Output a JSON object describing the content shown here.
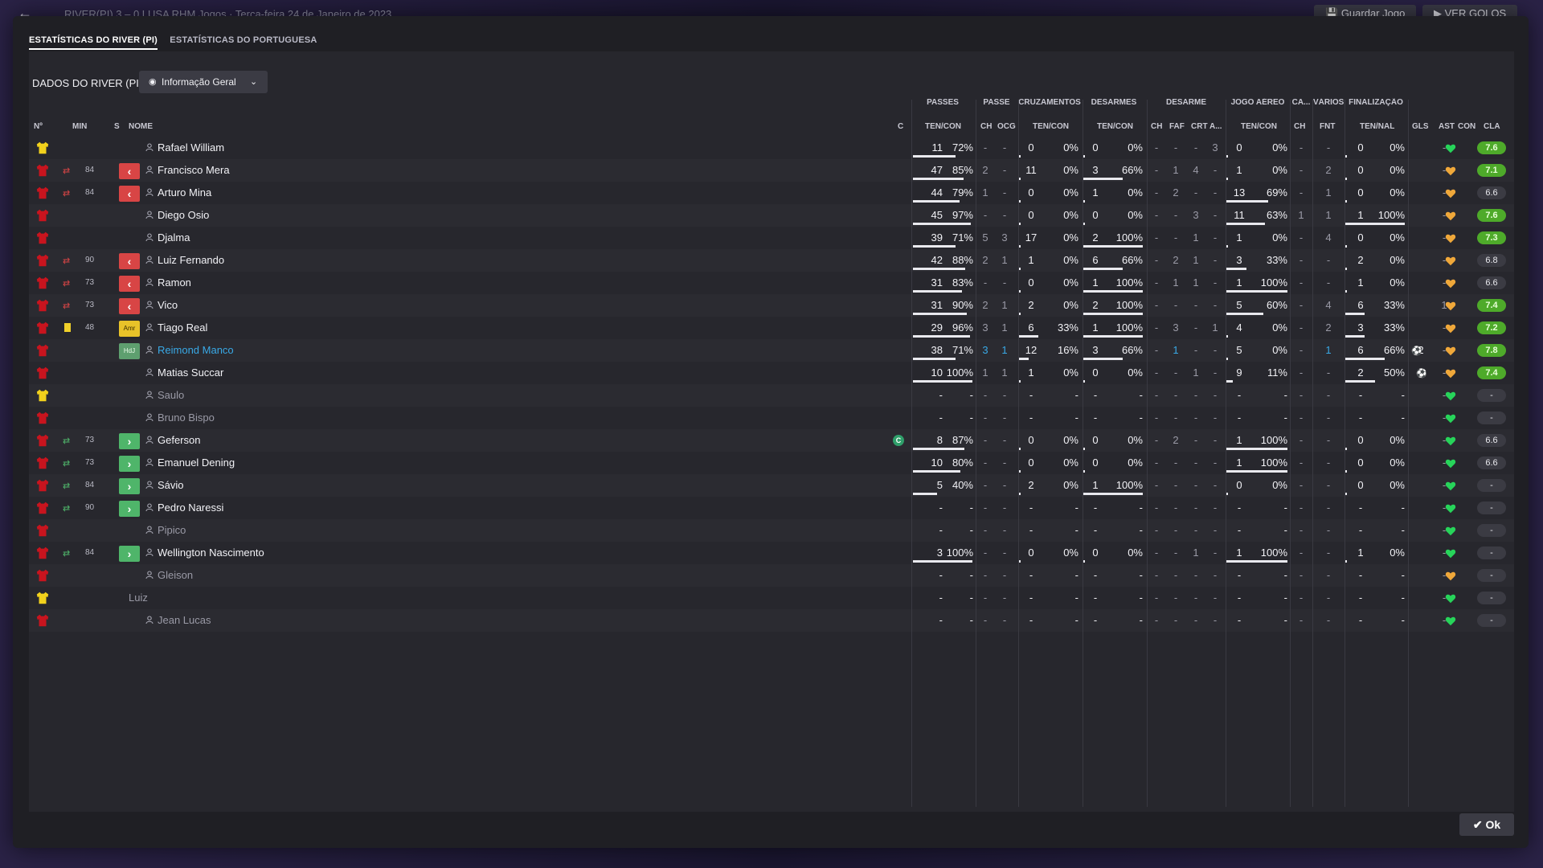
{
  "topbar": {
    "score": "RIVER(PI)  3 – 0  LUSA    RHM Jogos  ·  Terça-feira 24 de Janeiro de 2023",
    "save_label": "Guardar Jogo",
    "goals_label": "VER GOLOS"
  },
  "tabs": [
    "ESTATÍSTICAS DO RIVER (PI)",
    "ESTATÍSTICAS DO PORTUGUESA"
  ],
  "panel_title": "DADOS DO RIVER (PI)",
  "view_dropdown": "Informação Geral",
  "group_headers": {
    "passes": "PASSES",
    "passe": "PASSE",
    "cruzamentos": "CRUZAMENTOS",
    "desarmes": "DESARMES",
    "desarme": "DESARME",
    "jogo_aereo": "JOGO AÉREO",
    "ca": "CA...",
    "varios": "VÁRIOS",
    "finalizacao": "FINALIZAÇÃO"
  },
  "columns": {
    "no": "Nº",
    "min": "MIN",
    "s": "S",
    "nome": "NOME",
    "c": "C",
    "passes_tc": "TEN/CON",
    "ch1": "CH",
    "ocg": "OCG",
    "cruz_tc": "TEN/CON",
    "des_tc": "TEN/CON",
    "ch2": "CH",
    "faf": "FAF",
    "crt": "CRT",
    "a": "A...",
    "aer_tc": "TEN/CON",
    "ch3": "CH",
    "fnt": "FNT",
    "fin_tn": "TEN/NAL",
    "gls": "GLS",
    "ast": "AST",
    "con": "CON",
    "cla": "CLA"
  },
  "players": [
    {
      "kit": "gk",
      "min": "",
      "sub": "",
      "pos": "",
      "name": "Rafael William",
      "card": false,
      "c": "",
      "p": [
        "11",
        "72%"
      ],
      "ch1": "-",
      "ocg": "-",
      "cr": [
        "0",
        "0%"
      ],
      "de": [
        "0",
        "0%"
      ],
      "ch2": "-",
      "faf": "-",
      "crt": "-",
      "a": "3",
      "ae": [
        "0",
        "0%"
      ],
      "ch3": "-",
      "fnt": "-",
      "fi": [
        "0",
        "0%"
      ],
      "gls": "",
      "ast": "-",
      "con": "green",
      "cla": "7.6",
      "good": true,
      "pf": 0.72,
      "cf": 0,
      "df": 0,
      "af": 0,
      "ff": 0
    },
    {
      "kit": "o",
      "min": "84",
      "sub": "out",
      "pos": "",
      "name": "Francisco Mera",
      "card": false,
      "c": "",
      "p": [
        "47",
        "85%"
      ],
      "ch1": "2",
      "ocg": "-",
      "cr": [
        "11",
        "0%"
      ],
      "de": [
        "3",
        "66%"
      ],
      "ch2": "-",
      "faf": "1",
      "crt": "4",
      "a": "-",
      "ae": [
        "1",
        "0%"
      ],
      "ch3": "-",
      "fnt": "2",
      "fi": [
        "0",
        "0%"
      ],
      "gls": "",
      "ast": "-",
      "con": "orange",
      "cla": "7.1",
      "good": true,
      "pf": 0.85,
      "cf": 0,
      "df": 0.66,
      "af": 0,
      "ff": 0
    },
    {
      "kit": "o",
      "min": "84",
      "sub": "out",
      "pos": "",
      "name": "Arturo Mina",
      "card": false,
      "c": "",
      "p": [
        "44",
        "79%"
      ],
      "ch1": "1",
      "ocg": "-",
      "cr": [
        "0",
        "0%"
      ],
      "de": [
        "1",
        "0%"
      ],
      "ch2": "-",
      "faf": "2",
      "crt": "-",
      "a": "-",
      "ae": [
        "13",
        "69%"
      ],
      "ch3": "-",
      "fnt": "1",
      "fi": [
        "0",
        "0%"
      ],
      "gls": "",
      "ast": "-",
      "con": "orange",
      "cla": "6.6",
      "good": false,
      "pf": 0.79,
      "cf": 0,
      "df": 0,
      "af": 0.69,
      "ff": 0
    },
    {
      "kit": "o",
      "min": "",
      "sub": "",
      "pos": "",
      "name": "Diego Osio",
      "card": false,
      "c": "",
      "p": [
        "45",
        "97%"
      ],
      "ch1": "-",
      "ocg": "-",
      "cr": [
        "0",
        "0%"
      ],
      "de": [
        "0",
        "0%"
      ],
      "ch2": "-",
      "faf": "-",
      "crt": "3",
      "a": "-",
      "ae": [
        "11",
        "63%"
      ],
      "ch3": "1",
      "fnt": "1",
      "fi": [
        "1",
        "100%"
      ],
      "gls": "",
      "ast": "-",
      "con": "orange",
      "cla": "7.6",
      "good": true,
      "pf": 0.97,
      "cf": 0,
      "df": 0,
      "af": 0.63,
      "ff": 1
    },
    {
      "kit": "o",
      "min": "",
      "sub": "",
      "pos": "",
      "name": "Djalma",
      "card": false,
      "c": "",
      "p": [
        "39",
        "71%"
      ],
      "ch1": "5",
      "ocg": "3",
      "cr": [
        "17",
        "0%"
      ],
      "de": [
        "2",
        "100%"
      ],
      "ch2": "-",
      "faf": "-",
      "crt": "1",
      "a": "-",
      "ae": [
        "1",
        "0%"
      ],
      "ch3": "-",
      "fnt": "4",
      "fi": [
        "0",
        "0%"
      ],
      "gls": "",
      "ast": "-",
      "con": "orange",
      "cla": "7.3",
      "good": true,
      "pf": 0.71,
      "cf": 0,
      "df": 1,
      "af": 0,
      "ff": 0
    },
    {
      "kit": "o",
      "min": "90",
      "sub": "out",
      "pos": "",
      "name": "Luiz Fernando",
      "card": false,
      "c": "",
      "p": [
        "42",
        "88%"
      ],
      "ch1": "2",
      "ocg": "1",
      "cr": [
        "1",
        "0%"
      ],
      "de": [
        "6",
        "66%"
      ],
      "ch2": "-",
      "faf": "2",
      "crt": "1",
      "a": "-",
      "ae": [
        "3",
        "33%"
      ],
      "ch3": "-",
      "fnt": "-",
      "fi": [
        "2",
        "0%"
      ],
      "gls": "",
      "ast": "-",
      "con": "orange",
      "cla": "6.8",
      "good": false,
      "pf": 0.88,
      "cf": 0,
      "df": 0.66,
      "af": 0.33,
      "ff": 0
    },
    {
      "kit": "o",
      "min": "73",
      "sub": "out",
      "pos": "",
      "name": "Ramon",
      "card": false,
      "c": "",
      "p": [
        "31",
        "83%"
      ],
      "ch1": "-",
      "ocg": "-",
      "cr": [
        "0",
        "0%"
      ],
      "de": [
        "1",
        "100%"
      ],
      "ch2": "-",
      "faf": "1",
      "crt": "1",
      "a": "-",
      "ae": [
        "1",
        "100%"
      ],
      "ch3": "-",
      "fnt": "-",
      "fi": [
        "1",
        "0%"
      ],
      "gls": "",
      "ast": "-",
      "con": "orange",
      "cla": "6.6",
      "good": false,
      "pf": 0.83,
      "cf": 0,
      "df": 1,
      "af": 1,
      "ff": 0
    },
    {
      "kit": "o",
      "min": "73",
      "sub": "out",
      "pos": "",
      "name": "Vico",
      "card": false,
      "c": "",
      "p": [
        "31",
        "90%"
      ],
      "ch1": "2",
      "ocg": "1",
      "cr": [
        "2",
        "0%"
      ],
      "de": [
        "2",
        "100%"
      ],
      "ch2": "-",
      "faf": "-",
      "crt": "-",
      "a": "-",
      "ae": [
        "5",
        "60%"
      ],
      "ch3": "-",
      "fnt": "4",
      "fi": [
        "6",
        "33%"
      ],
      "gls": "",
      "ast": "1",
      "con": "orange",
      "cla": "7.4",
      "good": true,
      "pf": 0.9,
      "cf": 0,
      "df": 1,
      "af": 0.6,
      "ff": 0.33
    },
    {
      "kit": "o",
      "min": "48",
      "sub": "",
      "pos": "Amr",
      "name": "Tiago Real",
      "card": true,
      "c": "",
      "p": [
        "29",
        "96%"
      ],
      "ch1": "3",
      "ocg": "1",
      "cr": [
        "6",
        "33%"
      ],
      "de": [
        "1",
        "100%"
      ],
      "ch2": "-",
      "faf": "3",
      "crt": "-",
      "a": "1",
      "ae": [
        "4",
        "0%"
      ],
      "ch3": "-",
      "fnt": "2",
      "fi": [
        "3",
        "33%"
      ],
      "gls": "",
      "ast": "-",
      "con": "orange",
      "cla": "7.2",
      "good": true,
      "pf": 0.96,
      "cf": 0.33,
      "df": 1,
      "af": 0,
      "ff": 0.33
    },
    {
      "kit": "o",
      "min": "",
      "sub": "",
      "pos": "HdJ",
      "name": "Reimond Manco",
      "card": false,
      "c": "",
      "p": [
        "38",
        "71%"
      ],
      "ch1": "3",
      "ocg": "1",
      "cr": [
        "12",
        "16%"
      ],
      "de": [
        "3",
        "66%"
      ],
      "ch2": "-",
      "faf": "1",
      "crt": "-",
      "a": "-",
      "ae": [
        "5",
        "0%"
      ],
      "ch3": "-",
      "fnt": "1",
      "fi": [
        "6",
        "66%"
      ],
      "gls": "2",
      "ast": "-",
      "con": "orange",
      "cla": "7.8",
      "good": true,
      "pf": 0.71,
      "cf": 0.16,
      "df": 0.66,
      "af": 0,
      "ff": 0.66,
      "blue": true
    },
    {
      "kit": "o",
      "min": "",
      "sub": "",
      "pos": "",
      "name": "Matias Succar",
      "card": false,
      "c": "",
      "p": [
        "10",
        "100%"
      ],
      "ch1": "1",
      "ocg": "1",
      "cr": [
        "1",
        "0%"
      ],
      "de": [
        "0",
        "0%"
      ],
      "ch2": "-",
      "faf": "-",
      "crt": "1",
      "a": "-",
      "ae": [
        "9",
        "11%"
      ],
      "ch3": "-",
      "fnt": "-",
      "fi": [
        "2",
        "50%"
      ],
      "gls": "1",
      "ast": "-",
      "con": "orange",
      "cla": "7.4",
      "good": true,
      "pf": 1,
      "cf": 0,
      "df": 0,
      "af": 0.11,
      "ff": 0.5
    },
    {
      "kit": "gk",
      "min": "",
      "sub": "",
      "pos": "",
      "name": "Saulo",
      "card": false,
      "c": "",
      "p": [
        "-",
        "-"
      ],
      "ch1": "-",
      "ocg": "-",
      "cr": [
        "-",
        "-"
      ],
      "de": [
        "-",
        "-"
      ],
      "ch2": "-",
      "faf": "-",
      "crt": "-",
      "a": "-",
      "ae": [
        "-",
        "-"
      ],
      "ch3": "-",
      "fnt": "-",
      "fi": [
        "-",
        "-"
      ],
      "gls": "",
      "ast": "-",
      "con": "green",
      "cla": "-",
      "good": false,
      "dim": true
    },
    {
      "kit": "o",
      "min": "",
      "sub": "",
      "pos": "",
      "name": "Bruno Bispo",
      "card": false,
      "c": "",
      "p": [
        "-",
        "-"
      ],
      "ch1": "-",
      "ocg": "-",
      "cr": [
        "-",
        "-"
      ],
      "de": [
        "-",
        "-"
      ],
      "ch2": "-",
      "faf": "-",
      "crt": "-",
      "a": "-",
      "ae": [
        "-",
        "-"
      ],
      "ch3": "-",
      "fnt": "-",
      "fi": [
        "-",
        "-"
      ],
      "gls": "",
      "ast": "-",
      "con": "green",
      "cla": "-",
      "good": false,
      "dim": true
    },
    {
      "kit": "o",
      "min": "73",
      "sub": "in",
      "pos": "",
      "name": "Geferson",
      "card": false,
      "c": "C",
      "p": [
        "8",
        "87%"
      ],
      "ch1": "-",
      "ocg": "-",
      "cr": [
        "0",
        "0%"
      ],
      "de": [
        "0",
        "0%"
      ],
      "ch2": "-",
      "faf": "2",
      "crt": "-",
      "a": "-",
      "ae": [
        "1",
        "100%"
      ],
      "ch3": "-",
      "fnt": "-",
      "fi": [
        "0",
        "0%"
      ],
      "gls": "",
      "ast": "-",
      "con": "green",
      "cla": "6.6",
      "good": false,
      "pf": 0.87,
      "cf": 0,
      "df": 0,
      "af": 1,
      "ff": 0
    },
    {
      "kit": "o",
      "min": "73",
      "sub": "in",
      "pos": "",
      "name": "Emanuel Dening",
      "card": false,
      "c": "",
      "p": [
        "10",
        "80%"
      ],
      "ch1": "-",
      "ocg": "-",
      "cr": [
        "0",
        "0%"
      ],
      "de": [
        "0",
        "0%"
      ],
      "ch2": "-",
      "faf": "-",
      "crt": "-",
      "a": "-",
      "ae": [
        "1",
        "100%"
      ],
      "ch3": "-",
      "fnt": "-",
      "fi": [
        "0",
        "0%"
      ],
      "gls": "",
      "ast": "-",
      "con": "green",
      "cla": "6.6",
      "good": false,
      "pf": 0.8,
      "cf": 0,
      "df": 0,
      "af": 1,
      "ff": 0
    },
    {
      "kit": "o",
      "min": "84",
      "sub": "in",
      "pos": "",
      "name": "Sávio",
      "card": false,
      "c": "",
      "p": [
        "5",
        "40%"
      ],
      "ch1": "-",
      "ocg": "-",
      "cr": [
        "2",
        "0%"
      ],
      "de": [
        "1",
        "100%"
      ],
      "ch2": "-",
      "faf": "-",
      "crt": "-",
      "a": "-",
      "ae": [
        "0",
        "0%"
      ],
      "ch3": "-",
      "fnt": "-",
      "fi": [
        "0",
        "0%"
      ],
      "gls": "",
      "ast": "-",
      "con": "green",
      "cla": "-",
      "good": false,
      "pf": 0.4,
      "cf": 0,
      "df": 1,
      "af": 0,
      "ff": 0
    },
    {
      "kit": "o",
      "min": "90",
      "sub": "in",
      "pos": "",
      "name": "Pedro Naressi",
      "card": false,
      "c": "",
      "p": [
        "-",
        "-"
      ],
      "ch1": "-",
      "ocg": "-",
      "cr": [
        "-",
        "-"
      ],
      "de": [
        "-",
        "-"
      ],
      "ch2": "-",
      "faf": "-",
      "crt": "-",
      "a": "-",
      "ae": [
        "-",
        "-"
      ],
      "ch3": "-",
      "fnt": "-",
      "fi": [
        "-",
        "-"
      ],
      "gls": "",
      "ast": "-",
      "con": "green",
      "cla": "-",
      "good": false
    },
    {
      "kit": "o",
      "min": "",
      "sub": "",
      "pos": "",
      "name": "Pipico",
      "card": false,
      "c": "",
      "p": [
        "-",
        "-"
      ],
      "ch1": "-",
      "ocg": "-",
      "cr": [
        "-",
        "-"
      ],
      "de": [
        "-",
        "-"
      ],
      "ch2": "-",
      "faf": "-",
      "crt": "-",
      "a": "-",
      "ae": [
        "-",
        "-"
      ],
      "ch3": "-",
      "fnt": "-",
      "fi": [
        "-",
        "-"
      ],
      "gls": "",
      "ast": "-",
      "con": "green",
      "cla": "-",
      "good": false,
      "dim": true
    },
    {
      "kit": "o",
      "min": "84",
      "sub": "in",
      "pos": "",
      "name": "Wellington Nascimento",
      "card": false,
      "c": "",
      "p": [
        "3",
        "100%"
      ],
      "ch1": "-",
      "ocg": "-",
      "cr": [
        "0",
        "0%"
      ],
      "de": [
        "0",
        "0%"
      ],
      "ch2": "-",
      "faf": "-",
      "crt": "1",
      "a": "-",
      "ae": [
        "1",
        "100%"
      ],
      "ch3": "-",
      "fnt": "-",
      "fi": [
        "1",
        "0%"
      ],
      "gls": "",
      "ast": "-",
      "con": "green",
      "cla": "-",
      "good": false,
      "pf": 1,
      "cf": 0,
      "df": 0,
      "af": 1,
      "ff": 0
    },
    {
      "kit": "o",
      "min": "",
      "sub": "",
      "pos": "",
      "name": "Gleison",
      "card": false,
      "c": "",
      "p": [
        "-",
        "-"
      ],
      "ch1": "-",
      "ocg": "-",
      "cr": [
        "-",
        "-"
      ],
      "de": [
        "-",
        "-"
      ],
      "ch2": "-",
      "faf": "-",
      "crt": "-",
      "a": "-",
      "ae": [
        "-",
        "-"
      ],
      "ch3": "-",
      "fnt": "-",
      "fi": [
        "-",
        "-"
      ],
      "gls": "",
      "ast": "-",
      "con": "orange",
      "cla": "-",
      "good": false,
      "dim": true
    },
    {
      "kit": "gk",
      "min": "",
      "sub": "",
      "pos": "",
      "name": "Luiz",
      "card": false,
      "c": "",
      "p": [
        "-",
        "-"
      ],
      "ch1": "-",
      "ocg": "-",
      "cr": [
        "-",
        "-"
      ],
      "de": [
        "-",
        "-"
      ],
      "ch2": "-",
      "faf": "-",
      "crt": "-",
      "a": "-",
      "ae": [
        "-",
        "-"
      ],
      "ch3": "-",
      "fnt": "-",
      "fi": [
        "-",
        "-"
      ],
      "gls": "",
      "ast": "-",
      "con": "green",
      "cla": "-",
      "good": false,
      "dim": true,
      "noperson": true
    },
    {
      "kit": "o",
      "min": "",
      "sub": "",
      "pos": "",
      "name": "Jean Lucas",
      "card": false,
      "c": "",
      "p": [
        "-",
        "-"
      ],
      "ch1": "-",
      "ocg": "-",
      "cr": [
        "-",
        "-"
      ],
      "de": [
        "-",
        "-"
      ],
      "ch2": "-",
      "faf": "-",
      "crt": "-",
      "a": "-",
      "ae": [
        "-",
        "-"
      ],
      "ch3": "-",
      "fnt": "-",
      "fi": [
        "-",
        "-"
      ],
      "gls": "",
      "ast": "-",
      "con": "green",
      "cla": "-",
      "good": false,
      "dim": true
    }
  ],
  "ok_label": "Ok",
  "colors": {
    "kit_outfield": "#c8141e",
    "kit_gk": "#f2d11c",
    "heart_green": "#27d45a",
    "heart_orange": "#f0a83a",
    "rating_good": "#4eaa2a",
    "sub_out": "#d84545",
    "sub_in": "#4fb56a"
  }
}
